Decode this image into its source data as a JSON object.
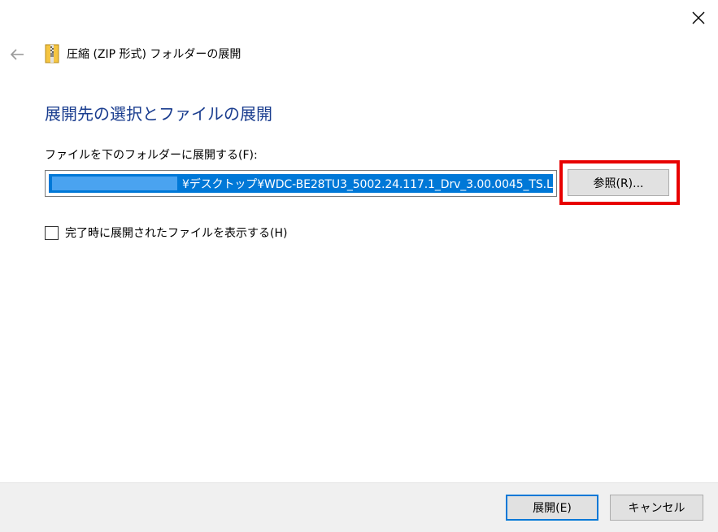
{
  "window": {
    "title": "圧縮 (ZIP 形式) フォルダーの展開",
    "close_icon": "close-icon",
    "back_icon": "back-arrow-icon",
    "zip_icon": "zip-folder-icon"
  },
  "main": {
    "heading": "展開先の選択とファイルの展開",
    "destination_label": "ファイルを下のフォルダーに展開する(F):",
    "destination_path": "¥デスクトップ¥WDC-BE28TU3_5002.24.117.1_Drv_3.00.0045_TS.L",
    "browse_label": "参照(R)...",
    "show_files_label": "完了時に展開されたファイルを表示する(H)",
    "show_files_checked": false
  },
  "footer": {
    "extract_label": "展開(E)",
    "cancel_label": "キャンセル"
  },
  "colors": {
    "heading": "#1a3d8f",
    "selection": "#0078d7",
    "highlight_box": "#e80000",
    "footer_bg": "#f0f0f0"
  }
}
